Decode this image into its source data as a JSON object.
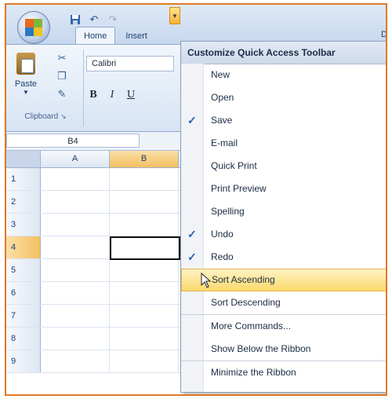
{
  "qat": {
    "save_icon": "save-icon",
    "undo_icon": "undo-icon",
    "redo_icon": "redo-icon",
    "dropdown_icon": "chevron-down-icon"
  },
  "tabs": [
    {
      "label": "Home",
      "active": true
    },
    {
      "label": "Insert",
      "active": false
    }
  ],
  "tab_overflow": "Da",
  "ribbon": {
    "paste_label": "Paste",
    "font_name": "Calibri",
    "bold": "B",
    "italic": "I",
    "underline": "U",
    "group_label": "Clipboard"
  },
  "name_box": "B4",
  "columns": [
    "A",
    "B"
  ],
  "rows": [
    "1",
    "2",
    "3",
    "4",
    "5",
    "6",
    "7",
    "8",
    "9"
  ],
  "selected_row": "4",
  "selected_column": "B",
  "menu": {
    "title": "Customize Quick Access Toolbar",
    "items": [
      {
        "label": "New",
        "checked": false
      },
      {
        "label": "Open",
        "checked": false
      },
      {
        "label": "Save",
        "checked": true
      },
      {
        "label": "E-mail",
        "checked": false
      },
      {
        "label": "Quick Print",
        "checked": false
      },
      {
        "label": "Print Preview",
        "checked": false
      },
      {
        "label": "Spelling",
        "checked": false
      },
      {
        "label": "Undo",
        "checked": true
      },
      {
        "label": "Redo",
        "checked": true
      },
      {
        "label": "Sort Ascending",
        "checked": false,
        "hover": true
      },
      {
        "label": "Sort Descending",
        "checked": false
      },
      {
        "label": "More Commands...",
        "checked": false
      },
      {
        "label": "Show Below the Ribbon",
        "checked": false
      },
      {
        "label": "Minimize the Ribbon",
        "checked": false
      }
    ],
    "check_mark": "✓"
  },
  "colors": {
    "accent_border": "#e07828",
    "hover_fill": "#fbd96c",
    "check_color": "#2c5fb0"
  }
}
